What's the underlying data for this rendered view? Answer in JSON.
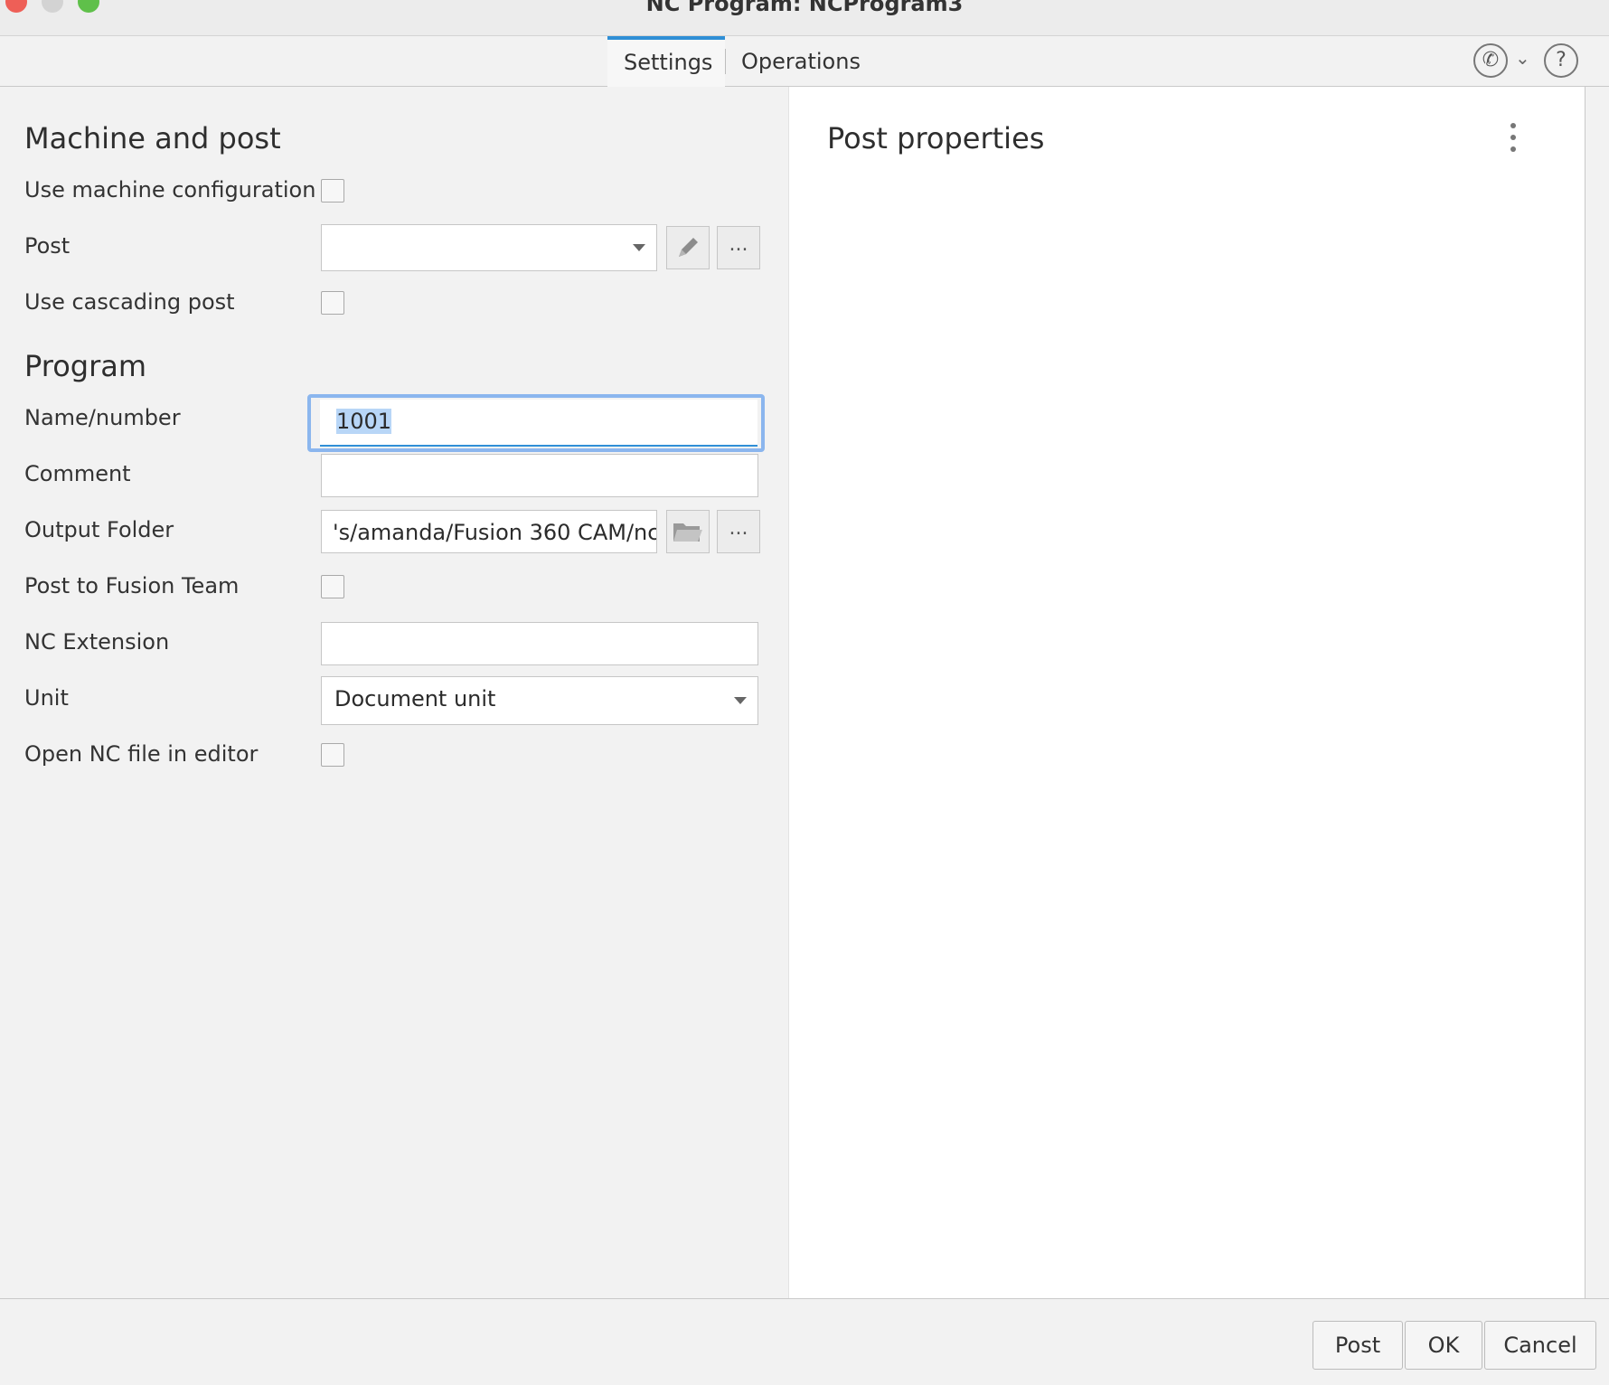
{
  "window": {
    "title": "NC Program: NCProgram3"
  },
  "tabs": [
    {
      "label": "Settings"
    },
    {
      "label": "Operations"
    }
  ],
  "icons": {
    "phone": "phone-icon",
    "help": "help-icon",
    "pencil": "pencil-icon",
    "folder": "folder-icon"
  },
  "machine_and_post": {
    "heading": "Machine and post",
    "use_machine_configuration": {
      "label": "Use machine configuration",
      "checked": false
    },
    "post": {
      "label": "Post",
      "value": "",
      "browse_label": "..."
    },
    "use_cascading_post": {
      "label": "Use cascading post",
      "checked": false
    }
  },
  "program": {
    "heading": "Program",
    "name_number": {
      "label": "Name/number",
      "value": "1001"
    },
    "comment": {
      "label": "Comment",
      "value": ""
    },
    "output_folder": {
      "label": "Output Folder",
      "value": "'s/amanda/Fusion 360 CAM/nc",
      "browse_label": "..."
    },
    "post_to_fusion_team": {
      "label": "Post to Fusion Team",
      "checked": false
    },
    "nc_extension": {
      "label": "NC Extension",
      "value": ""
    },
    "unit": {
      "label": "Unit",
      "value": "Document unit"
    },
    "open_nc_file_in_editor": {
      "label": "Open NC file in editor",
      "checked": false
    }
  },
  "post_properties": {
    "heading": "Post properties"
  },
  "footer": {
    "post_label": "Post",
    "ok_label": "OK",
    "cancel_label": "Cancel"
  },
  "colors": {
    "accent": "#2f8fd6",
    "focus": "#8bb6ee",
    "selection": "#b8d6f7"
  }
}
